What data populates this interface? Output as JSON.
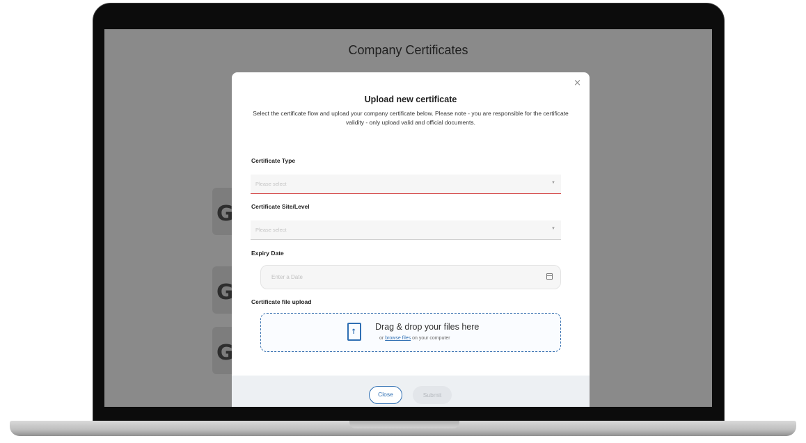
{
  "page": {
    "title": "Company Certificates",
    "card_glyph": "G"
  },
  "modal": {
    "close_icon": "×",
    "title": "Upload new certificate",
    "description": "Select the certificate flow and upload your company certificate below. Please note - you are responsible for the certificate validity - only upload valid and official documents.",
    "fields": {
      "type": {
        "label": "Certificate Type",
        "placeholder": "Please select"
      },
      "site": {
        "label": "Certificate Site/Level",
        "placeholder": "Please select"
      },
      "expiry": {
        "label": "Expiry Date",
        "placeholder": "Enter a Date"
      },
      "upload": {
        "label": "Certificate file upload",
        "drop_title": "Drag & drop your files here",
        "drop_prefix": "or",
        "drop_link": "browse files",
        "drop_suffix": "on your computer"
      }
    },
    "footer": {
      "close_label": "Close",
      "submit_label": "Submit"
    }
  },
  "colors": {
    "accent": "#2f6fb3",
    "error": "#d33a3a",
    "overlay": "#8a8a8a"
  },
  "icons": {
    "close": "close-icon",
    "dropdown": "chevron-down-icon",
    "calendar": "calendar-icon",
    "upload": "file-upload-icon"
  }
}
